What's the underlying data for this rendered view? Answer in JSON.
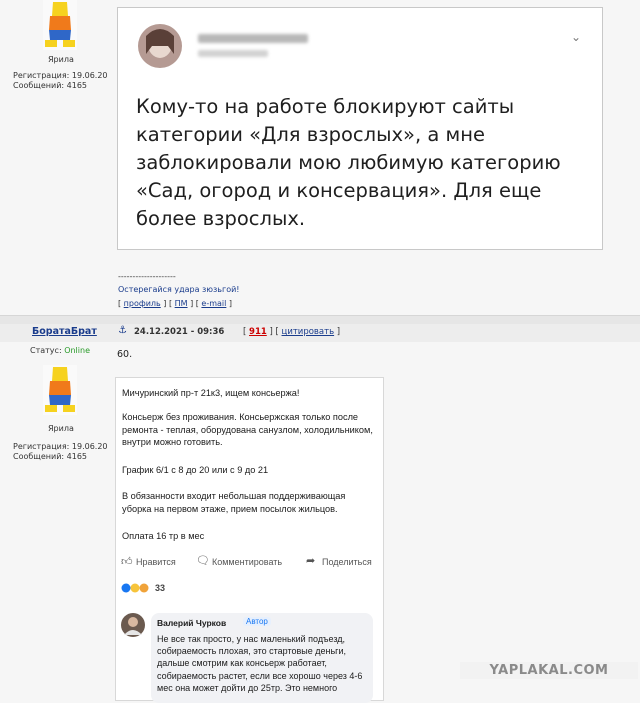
{
  "post1": {
    "user_title": "Ярила",
    "reg_label": "Регистрация: 19.06.20",
    "msgs_label": "Сообщений: 4165",
    "tweet_text": "Кому-то на работе блокируют сайты категории «Для взрослых», а мне заблокировали мою любимую категорию «Сад, огород и консервация». Для еще более взрослых.",
    "signature_line": "--------------------",
    "signature": "Остерегайся удара зюзьгой!",
    "links": {
      "profile": "профиль",
      "pm": "ПМ",
      "email": "e-mail"
    }
  },
  "post2": {
    "username": "БоратаБрат",
    "datetime": "24.12.2021 - 09:36",
    "post_number": "911",
    "quote_label": "цитировать",
    "status_label": "Статус:",
    "status_value": "Online",
    "user_title": "Ярила",
    "reg_label": "Регистрация: 19.06.20",
    "msgs_label": "Сообщений: 4165",
    "text": "60.",
    "fb_post": {
      "p1": "Мичуринский пр-т 21к3,  ищем консьержа!",
      "p2": "Консьерж без проживания. Консьержская только после ремонта - теплая, оборудована санузлом, холодильником, внутри можно готовить.",
      "p3": "График 6/1 с 8 до 20 или с 9 до 21",
      "p4": "В обязанности входит небольшая поддерживающая уборка на первом этаже, прием посылок жильцов.",
      "p5": "Оплата 16 тр в мес",
      "like": "Нравится",
      "comment": "Комментировать",
      "share": "Поделиться",
      "reactions_count": "33",
      "commenter": "Валерий Чурков",
      "author_badge": "Автор",
      "comment_text": "Не все так просто, у нас маленький подъезд, собираемость плохая, это стартовые деньги, дальше смотрим как консьерж работает, собираемость растет, если все хорошо через 4-6 мес она может дойти до 25тр. Это немного"
    }
  },
  "watermark": "YAPLAKAL.COM"
}
